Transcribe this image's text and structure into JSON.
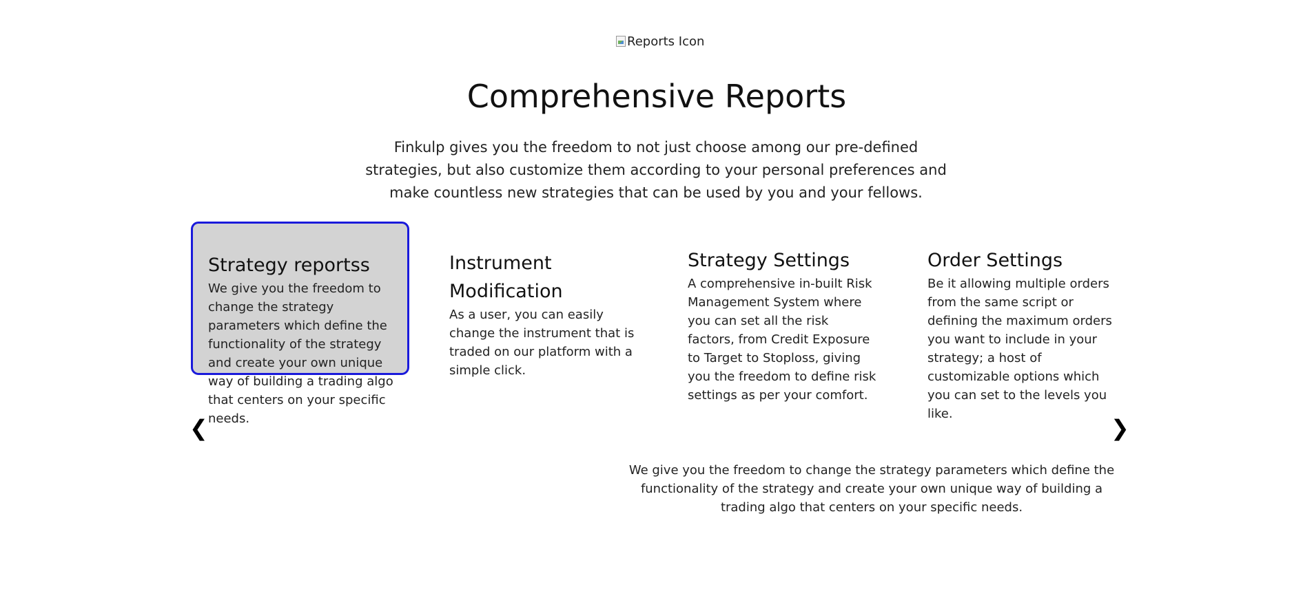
{
  "hero": {
    "icon_alt": "Reports Icon",
    "title": "Comprehensive Reports",
    "description": "Finkulp gives you the freedom to not just choose among our pre-defined strategies, but also customize them according to your personal preferences and make countless new strategies that can be used by you and your fellows."
  },
  "cards": [
    {
      "title": "Strategy reportss",
      "text": "We give you the freedom to change the strategy parameters which define the functionality of the strategy and create your own unique way of building a trading algo that centers on your specific needs.",
      "active": true
    },
    {
      "title": "Instrument Modification",
      "text": "As a user, you can easily change the instrument that is traded on our platform with a simple click.",
      "active": false
    },
    {
      "title": "Strategy Settings",
      "text": "A comprehensive in-built Risk Management System where you can set all the risk factors, from Credit Exposure to Target to Stoploss, giving you the freedom to define risk settings as per your comfort.",
      "active": false
    },
    {
      "title": "Order Settings",
      "text": "Be it allowing multiple orders from the same script or defining the maximum orders you want to include in your strategy; a host of customizable options which you can set to the levels you like.",
      "active": false
    }
  ],
  "nav": {
    "prev_glyph": "❮",
    "next_glyph": "❯"
  },
  "detail": {
    "text": "We give you the freedom to change the strategy parameters which define the functionality of the strategy and create your own unique way of building a trading algo that centers on your specific needs."
  },
  "colors": {
    "active_card_bg": "#d3d3d3",
    "active_card_border": "#1a1adb"
  }
}
